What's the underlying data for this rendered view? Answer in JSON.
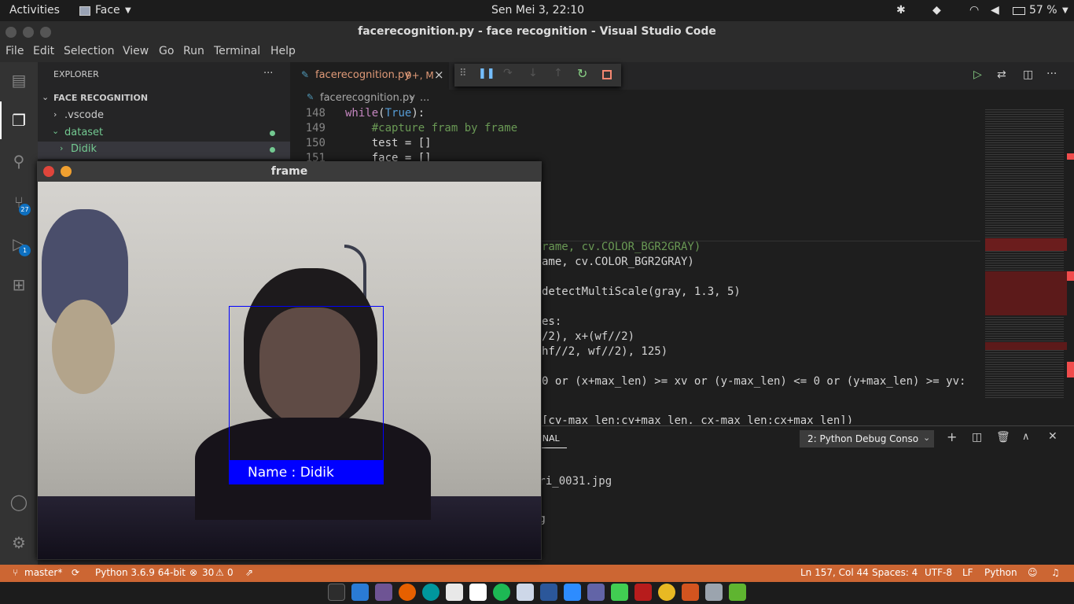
{
  "topbar": {
    "activities": "Activities",
    "app": "Face",
    "datetime": "Sen Mei  3, 22:10",
    "battery": "57 %"
  },
  "window": {
    "title": "facerecognition.py - face recognition - Visual Studio Code"
  },
  "menu": [
    "File",
    "Edit",
    "Selection",
    "View",
    "Go",
    "Run",
    "Terminal",
    "Help"
  ],
  "activity_badges": {
    "scm": "27",
    "debug": "1"
  },
  "explorer": {
    "header": "EXPLORER",
    "more": "···",
    "project": "FACE RECOGNITION",
    "items": [
      ".vscode",
      "dataset",
      "Didik"
    ]
  },
  "tab": {
    "name": "facerecognition.py",
    "status": "9+, M",
    "close": "×"
  },
  "breadcrumb": {
    "file": "facerecognition.py",
    "sep": "›",
    "more": "..."
  },
  "code": {
    "lines": [
      "148",
      "149",
      "150",
      "151"
    ],
    "l148": {
      "kw": "while",
      "p1": "(",
      "val": "True",
      "p2": "):"
    },
    "l149": "    #capture fram by frame",
    "l150": "    test = []",
    "l151": "    face = []",
    "peek": "rame, cv.COLOR_BGR2GRAY)",
    "frags": {
      "f1": "ame, cv.COLOR_BGR2GRAY)",
      "f2": "detectMultiScale(gray, 1.3, 5)",
      "f3": "es:",
      "f4": "/2), x+(wf//2)",
      "f5": "hf//2, wf//2), 125)",
      "f6": "0 or (x+max_len) >= xv or (y-max_len) <= 0 or (y+max_len) >= yv:",
      "f7": "[cy-max_len:cy+max_len, cx-max_len:cx+max_len])"
    }
  },
  "panel": {
    "tab": "MINAL",
    "console": "2: Python Debug Conso",
    "out1": "tri_0031.jpg",
    "out2": "pg"
  },
  "statusbar": {
    "branch": "master*",
    "python": "Python 3.6.9 64-bit",
    "errors": "30",
    "warnings": "0",
    "position": "Ln 157, Col 44",
    "spaces": "Spaces: 4",
    "encoding": "UTF-8",
    "eol": "LF",
    "language": "Python"
  },
  "frame": {
    "title": "frame",
    "label": "Name : Didik"
  },
  "colors": {
    "accent": "#cc6633",
    "bbox": "#0000ff",
    "keyword": "#c586c0",
    "comment": "#6a9955",
    "constant": "#569cd6"
  }
}
